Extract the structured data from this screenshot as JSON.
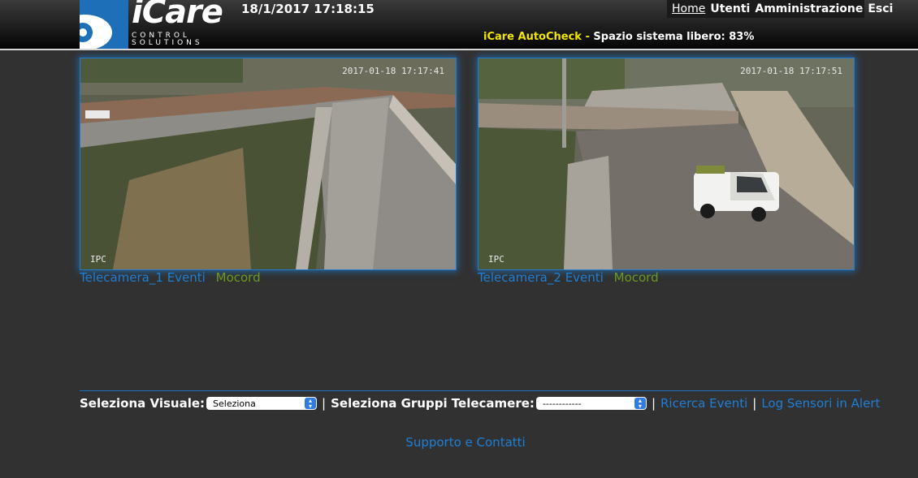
{
  "header": {
    "logo_text": "iCare",
    "logo_sub_1": "CONTROL",
    "logo_sub_2": "SOLUTIONS",
    "datetime": "18/1/2017 17:18:15",
    "nav": [
      "Home",
      "Utenti",
      "Amministrazione",
      "Esci"
    ],
    "autocheck_label": "iCare AutoCheck -",
    "autocheck_text": "Spazio sistema libero: 83%"
  },
  "cameras": [
    {
      "name": "Telecamera_1",
      "events_label": "Eventi",
      "recorder_label": "Mocord",
      "timestamp": "2017-01-18 17:17:41",
      "overlay": "IPC"
    },
    {
      "name": "Telecamera_2",
      "events_label": "Eventi",
      "recorder_label": "Mocord",
      "timestamp": "2017-01-18 17:17:51",
      "overlay": "IPC"
    }
  ],
  "controls": {
    "visual_label": "Seleziona Visuale:",
    "visual_value": "Seleziona",
    "groups_label": "Seleziona Gruppi Telecamere:",
    "groups_value": "------------",
    "search_events": "Ricerca Eventi",
    "sensor_log": "Log Sensori in Alert"
  },
  "footer": {
    "support": "Supporto e Contatti"
  },
  "colors": {
    "link": "#1f7fd6",
    "recorder": "#6c9a22",
    "autocheck": "#f2e600",
    "accent": "#1d6fb8"
  }
}
